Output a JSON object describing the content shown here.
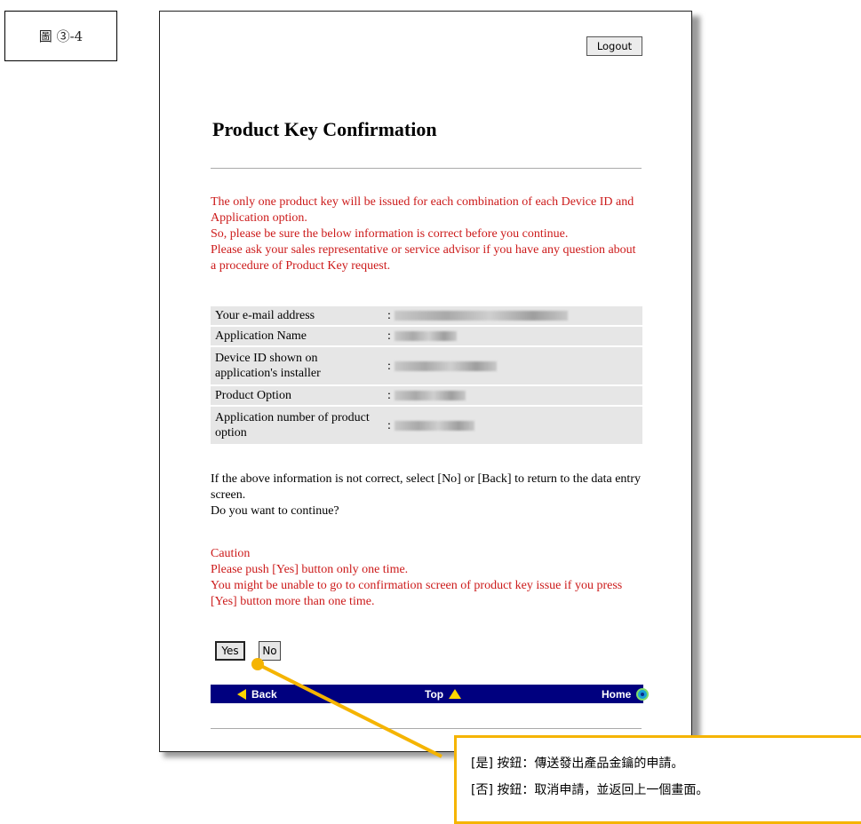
{
  "figure_label": "圖 ③-4",
  "header": {
    "logout_label": "Logout"
  },
  "page_title": "Product Key Confirmation",
  "notice_lines": [
    "The only one product key will be issued for each combination of each Device ID and Application option.",
    "So, please be sure the below information is correct before you continue.",
    "Please ask your sales representative or service advisor if you have any question about a procedure of Product Key request."
  ],
  "info_rows": [
    {
      "label": "Your e-mail address",
      "value": ":"
    },
    {
      "label": "Application Name",
      "value": ":"
    },
    {
      "label": "Device ID shown on application's installer",
      "value": ":"
    },
    {
      "label": "Product Option",
      "value": ":"
    },
    {
      "label": "Application number of product option",
      "value": ":"
    }
  ],
  "instruction_lines": [
    "If the above information is not correct, select [No] or [Back] to return to the data entry screen.",
    "Do you want to continue?"
  ],
  "caution_lines": [
    "Caution",
    "Please push [Yes] button only one time.",
    "You might be unable to go to confirmation screen of product key issue if you press [Yes] button more than one time."
  ],
  "buttons": {
    "yes_label": "Yes",
    "no_label": "No"
  },
  "nav": {
    "back_label": "Back",
    "top_label": "Top",
    "home_label": "Home"
  },
  "callout_lines": [
    "[是] 按鈕：傳送發出產品金鑰的申請。",
    "[否] 按鈕：取消申請，並返回上一個畫面。"
  ],
  "colors": {
    "callout_accent": "#f5b400",
    "warning_text": "#cc1a1a",
    "nav_bar": "#00007f"
  }
}
